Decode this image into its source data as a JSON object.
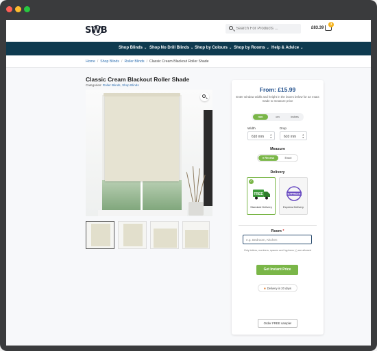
{
  "header": {
    "logo": "SWB",
    "search_placeholder": "Search For Products ...",
    "cart_total": "£83.39",
    "cart_count": "3"
  },
  "nav": {
    "items": [
      {
        "label": "Shop Blinds"
      },
      {
        "label": "Shop No Drill Blinds"
      },
      {
        "label": "Shop by Colours"
      },
      {
        "label": "Shop by Rooms"
      },
      {
        "label": "Help & Advice"
      }
    ]
  },
  "breadcrumb": {
    "items": [
      "Home",
      "Shop Blinds",
      "Roller Blinds",
      "Classic Cream Blackout Roller Shade"
    ]
  },
  "product": {
    "title": "Classic Cream Blackout Roller Shade",
    "categories_label": "Categories:",
    "categories": "Roller Blinds, Shop Blinds"
  },
  "panel": {
    "price": "From: £15.99",
    "instructions": "Enter window width and height in the boxes below for an exact made to measure price",
    "units": [
      "mm",
      "cm",
      "inches"
    ],
    "selected_unit": "mm",
    "width_label": "Width",
    "width_value": "610 mm",
    "drop_label": "Drop",
    "drop_value": "610 mm",
    "measure_title": "Measure",
    "measure_options": [
      "Recess",
      "Exact"
    ],
    "delivery_title": "Delivery",
    "delivery_options": [
      {
        "label": "Standard Delivery",
        "badge": "FREE"
      },
      {
        "label": "Express Delivery",
        "badge": "EXPRESS"
      }
    ],
    "room_label": "Room",
    "room_required": "*",
    "room_placeholder": "e.g. Bedroom, Kitchen",
    "room_hint": "Only letters, numbers, spaces and hyphens (-) are allowed",
    "instant_price_label": "Get Instant Price",
    "delivery_badge": "Delivery in 20 days",
    "sample_label": "Order FREE sample!"
  },
  "colors": {
    "nav_bg": "#0e3a4f",
    "accent_green": "#7ab648",
    "price_blue": "#1e4d8a",
    "link_blue": "#2e6fb0"
  }
}
